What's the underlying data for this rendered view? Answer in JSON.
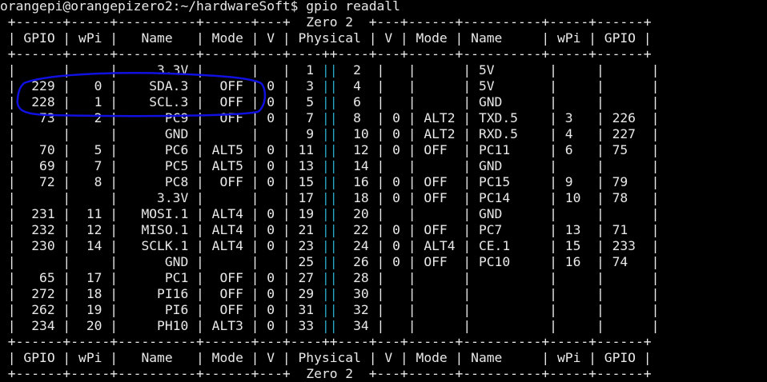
{
  "terminal": {
    "prompt": "orangepi@orangepizero2:~/hardwareSoft$ ",
    "command": "gpio readall",
    "board_label": "Zero 2",
    "border_top": " +------+-----+----------+------+---+  Zero 2  +---+------+----------+-----+------+",
    "border_mid": " +------+-----+----------+------+---+----++----+---+------+----------+-----+------+",
    "border_bottom_label": " +------+-----+----------+------+---+  Zero 2  +---+------+----------+-----+------+",
    "header": {
      "left": " | GPIO | wPi |   Name   | Mode | V | Physical ",
      "sep": "|",
      "right": " V | Mode | Name     | wPi | GPIO |"
    },
    "rows": [
      {
        "left": " |      |     |     3.3V |      |   |  1 ",
        "right": "  2  |   |      | 5V       |     |      |"
      },
      {
        "left": " |  229 |   0 |    SDA.3 |  OFF | 0 |  3 ",
        "right": "  4  |   |      | 5V       |     |      |"
      },
      {
        "left": " |  228 |   1 |    SCL.3 |  OFF | 0 |  5 ",
        "right": "  6  |   |      | GND      |     |      |"
      },
      {
        "left": " |   73 |   2 |      PC9 |  OFF | 0 |  7 ",
        "right": "  8  | 0 | ALT2 | TXD.5    | 3   | 226  |"
      },
      {
        "left": " |      |     |      GND |      |   |  9 ",
        "right": "  10 | 0 | ALT2 | RXD.5    | 4   | 227  |"
      },
      {
        "left": " |   70 |   5 |      PC6 | ALT5 | 0 | 11 ",
        "right": "  12 | 0 | OFF  | PC11     | 6   | 75   |"
      },
      {
        "left": " |   69 |   7 |      PC5 | ALT5 | 0 | 13 ",
        "right": "  14 |   |      | GND      |     |      |"
      },
      {
        "left": " |   72 |   8 |      PC8 |  OFF | 0 | 15 ",
        "right": "  16 | 0 | OFF  | PC15     | 9   | 79   |"
      },
      {
        "left": " |      |     |     3.3V |      |   | 17 ",
        "right": "  18 | 0 | OFF  | PC14     | 10  | 78   |"
      },
      {
        "left": " |  231 |  11 |   MOSI.1 | ALT4 | 0 | 19 ",
        "right": "  20 |   |      | GND      |     |      |"
      },
      {
        "left": " |  232 |  12 |   MISO.1 | ALT4 | 0 | 21 ",
        "right": "  22 | 0 | OFF  | PC7      | 13  | 71   |"
      },
      {
        "left": " |  230 |  14 |   SCLK.1 | ALT4 | 0 | 23 ",
        "right": "  24 | 0 | ALT4 | CE.1     | 15  | 233  |"
      },
      {
        "left": " |      |     |      GND |      |   | 25 ",
        "right": "  26 | 0 | OFF  | PC10     | 16  | 74   |"
      },
      {
        "left": " |   65 |  17 |      PC1 |  OFF | 0 | 27 ",
        "right": "  28 |   |      |          |     |      |"
      },
      {
        "left": " |  272 |  18 |     PI16 |  OFF | 0 | 29 ",
        "right": "  30 |   |      |          |     |      |"
      },
      {
        "left": " |  262 |  19 |      PI6 |  OFF | 0 | 31 ",
        "right": "  32 |   |      |          |     |      |"
      },
      {
        "left": " |  234 |  20 |     PH10 | ALT3 | 0 | 33 ",
        "right": "  34 |   |      |          |     |      |"
      }
    ],
    "divider": "||"
  },
  "annotation": {
    "color": "#1010e0",
    "label": "hand-drawn highlight around SDA.3 and SCL.3 rows"
  },
  "colors": {
    "background": "#000000",
    "text": "#e8e8e8",
    "divider": "#2aa8c8"
  }
}
